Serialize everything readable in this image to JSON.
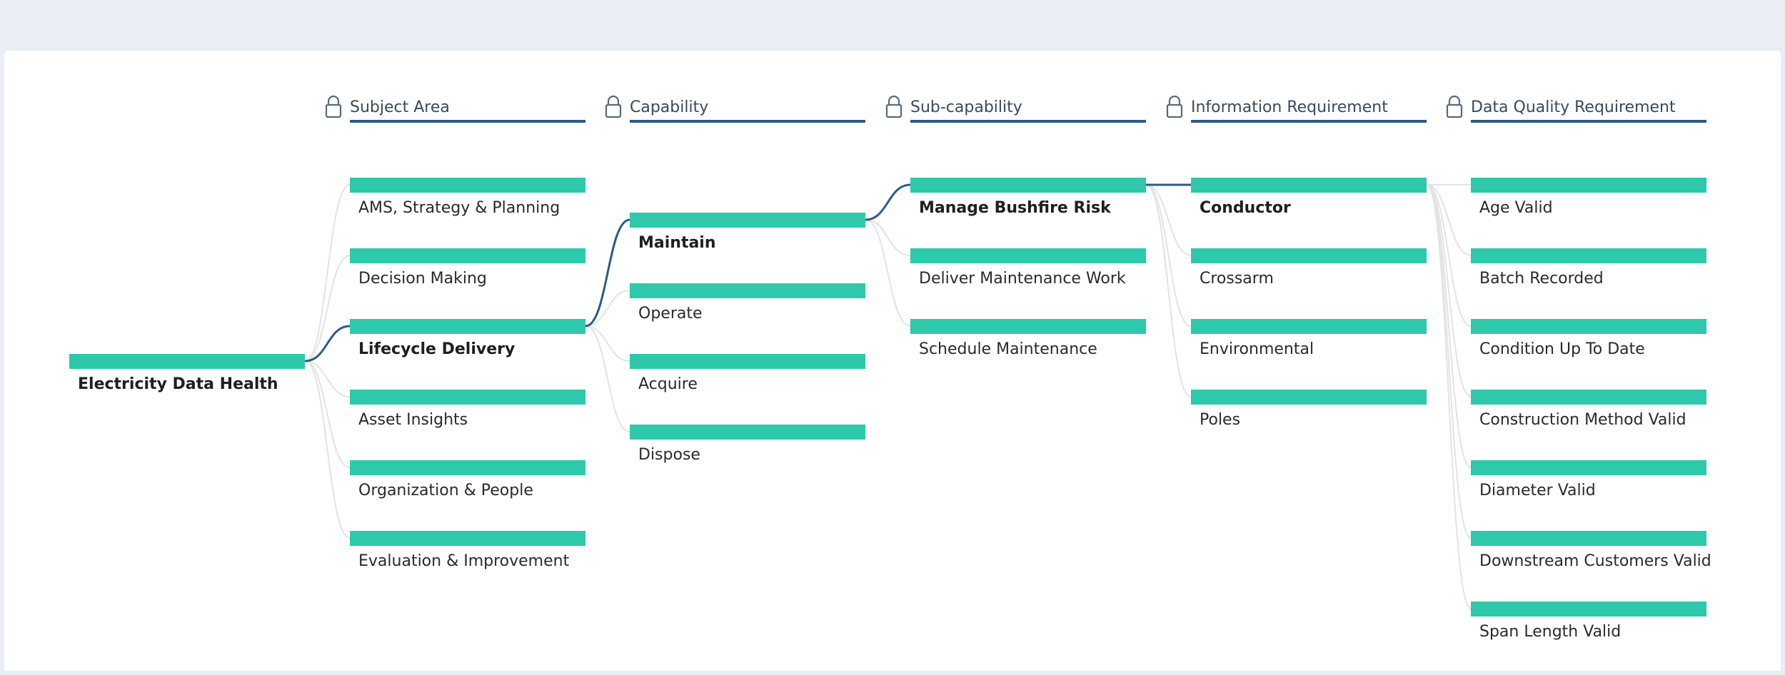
{
  "headers": [
    {
      "label": "Subject Area"
    },
    {
      "label": "Capability"
    },
    {
      "label": "Sub-capability"
    },
    {
      "label": "Information Requirement"
    },
    {
      "label": "Data Quality Requirement"
    }
  ],
  "root": {
    "label": "Electricity Data Health"
  },
  "subject_areas": [
    {
      "label": "AMS, Strategy & Planning"
    },
    {
      "label": "Decision Making"
    },
    {
      "label": "Lifecycle Delivery",
      "selected": true
    },
    {
      "label": "Asset Insights"
    },
    {
      "label": "Organization & People"
    },
    {
      "label": "Evaluation & Improvement"
    }
  ],
  "capabilities": [
    {
      "label": "Maintain",
      "selected": true
    },
    {
      "label": "Operate"
    },
    {
      "label": "Acquire"
    },
    {
      "label": "Dispose"
    }
  ],
  "sub_capabilities": [
    {
      "label": "Manage Bushfire Risk",
      "selected": true
    },
    {
      "label": "Deliver Maintenance Work"
    },
    {
      "label": "Schedule Maintenance"
    }
  ],
  "information_requirements": [
    {
      "label": "Conductor",
      "selected": true
    },
    {
      "label": "Crossarm"
    },
    {
      "label": "Environmental"
    },
    {
      "label": "Poles"
    }
  ],
  "data_quality_requirements": [
    {
      "label": "Age Valid"
    },
    {
      "label": "Batch Recorded"
    },
    {
      "label": "Condition Up To Date"
    },
    {
      "label": "Construction Method Valid"
    },
    {
      "label": "Diameter Valid"
    },
    {
      "label": "Downstream Customers Valid"
    },
    {
      "label": "Span Length Valid"
    }
  ],
  "colors": {
    "bar": "#2ec8aa",
    "header_line": "#2e5a86",
    "selected_link": "#2e5a86",
    "link": "#e3e3e3",
    "background": "#e8eef4"
  }
}
